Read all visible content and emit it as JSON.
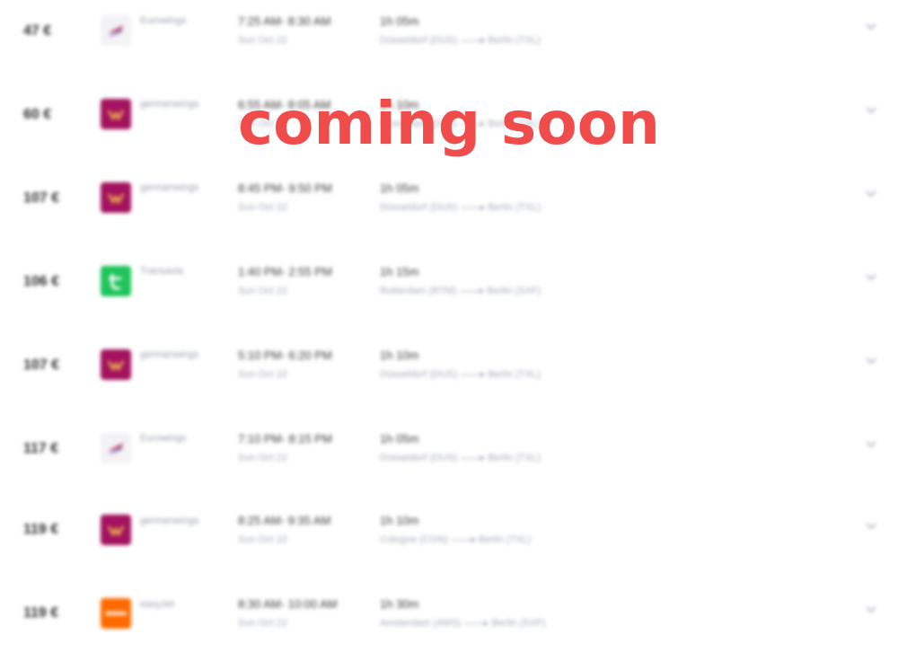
{
  "flights": [
    {
      "price": "47 €",
      "airline": "Eurowings",
      "logo": "eurowings-logo-icon",
      "times": "7:25 AM- 8:30 AM",
      "date": "Sun Oct 22",
      "duration": "1h 05m",
      "from": "Düsseldorf (DUS)",
      "to": "Berlin (TXL)"
    },
    {
      "price": "60 €",
      "airline": "germanwings",
      "logo": "germanwings-logo-icon",
      "times": "6:55 AM- 8:05 AM",
      "date": "Sun Oct 22",
      "duration": "1h 10m",
      "from": "Düsseldorf (DUS)",
      "to": "Berlin (TXL)"
    },
    {
      "price": "107 €",
      "airline": "germanwings",
      "logo": "germanwings-logo-icon",
      "times": "8:45 PM- 9:50 PM",
      "date": "Sun Oct 22",
      "duration": "1h 05m",
      "from": "Düsseldorf (DUS)",
      "to": "Berlin (TXL)"
    },
    {
      "price": "106 €",
      "airline": "Transavia",
      "logo": "transavia-logo-icon",
      "times": "1:40 PM- 2:55 PM",
      "date": "Sun Oct 22",
      "duration": "1h 15m",
      "from": "Rotterdam (RTM)",
      "to": "Berlin (SXF)"
    },
    {
      "price": "107 €",
      "airline": "germanwings",
      "logo": "germanwings-logo-icon",
      "times": "5:10 PM- 6:20 PM",
      "date": "Sun Oct 22",
      "duration": "1h 10m",
      "from": "Düsseldorf (DUS)",
      "to": "Berlin (TXL)"
    },
    {
      "price": "117 €",
      "airline": "Eurowings",
      "logo": "eurowings-logo-icon",
      "times": "7:10 PM- 8:15 PM",
      "date": "Sun Oct 22",
      "duration": "1h 05m",
      "from": "Düsseldorf (DUS)",
      "to": "Berlin (TXL)"
    },
    {
      "price": "119 €",
      "airline": "germanwings",
      "logo": "germanwings-logo-icon",
      "times": "8:25 AM- 9:35 AM",
      "date": "Sun Oct 22",
      "duration": "1h 10m",
      "from": "Cologne (CGN)",
      "to": "Berlin (TXL)"
    },
    {
      "price": "119 €",
      "airline": "easyJet",
      "logo": "easyjet-logo-icon",
      "times": "8:30 AM- 10:00 AM",
      "date": "Sun Oct 22",
      "duration": "1h 30m",
      "from": "Amsterdam (AMS)",
      "to": "Berlin (SXF)"
    }
  ],
  "overlay": {
    "text": "coming soon",
    "color": "#f04c4c"
  },
  "colors": {
    "eurowings": "#f3f3f5",
    "germanwings": "#a3125e",
    "transavia": "#1fc45b",
    "easyjet": "#ff6a00"
  }
}
